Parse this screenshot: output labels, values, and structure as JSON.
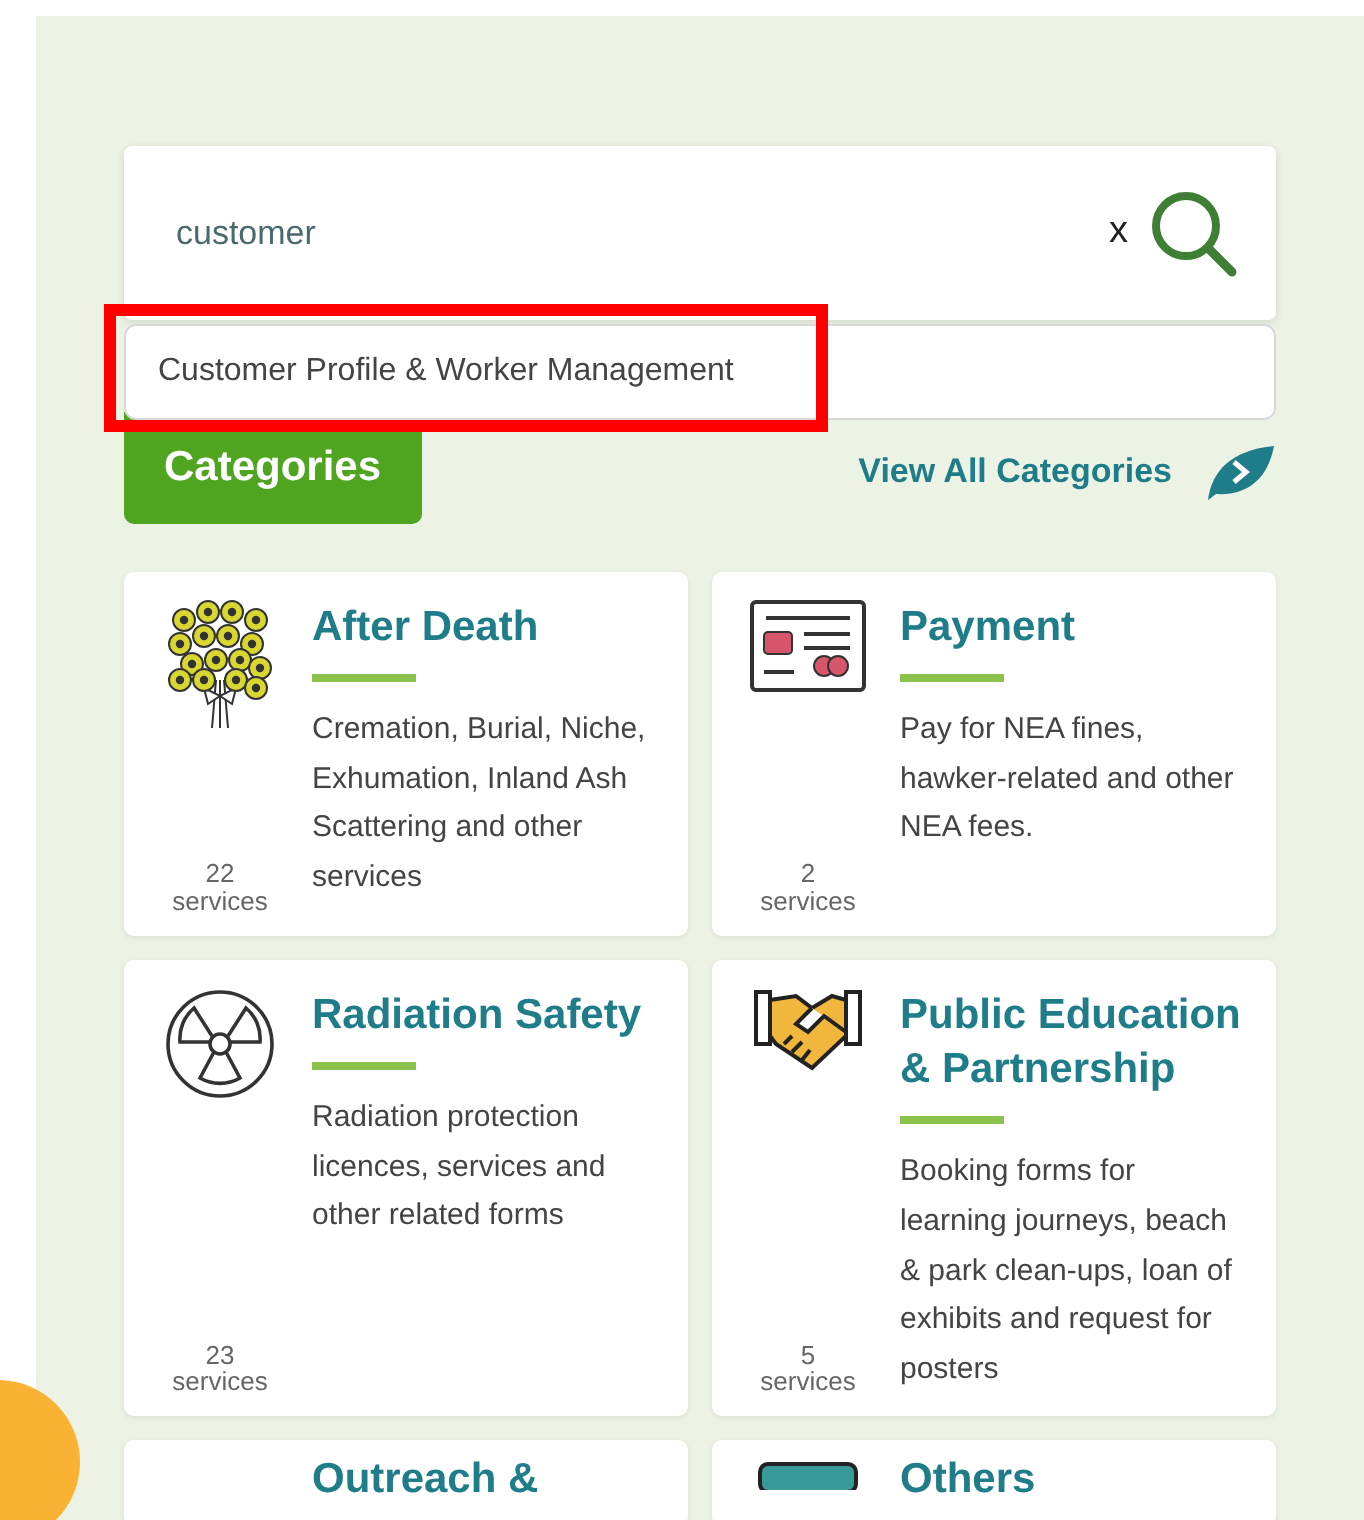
{
  "search": {
    "value": "customer",
    "clear": "x"
  },
  "suggestions": [
    {
      "label": "Customer Profile & Worker Management",
      "highlighted": true
    }
  ],
  "categories_button": "Categories",
  "view_all": "View All Categories",
  "cards": [
    {
      "title": "After Death",
      "description": "Cremation, Burial, Niche, Exhumation, Inland Ash Scattering and other services",
      "count": "22",
      "unit": "services"
    },
    {
      "title": "Payment",
      "description": "Pay for NEA fines, hawker-related and other NEA fees.",
      "count": "2",
      "unit": "services"
    },
    {
      "title": "Radiation Safety",
      "description": "Radiation protection licences, services and other related forms",
      "count": "23",
      "unit": "services"
    },
    {
      "title": "Public Education & Partnership",
      "description": "Booking forms for learning journeys, beach & park clean-ups, loan of exhibits and request for posters",
      "count": "5",
      "unit": "services"
    },
    {
      "title": "Outreach &"
    },
    {
      "title": "Others"
    }
  ]
}
